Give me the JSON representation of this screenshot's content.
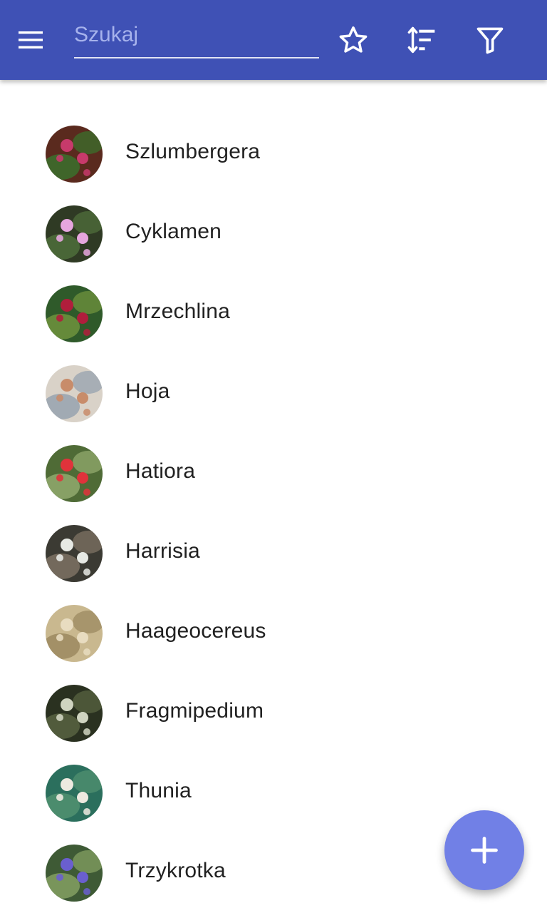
{
  "toolbar": {
    "search_placeholder": "Szukaj",
    "search_value": "",
    "menu_icon": "hamburger-menu-icon",
    "favorite_icon": "star-outline-icon",
    "sort_icon": "sort-icon",
    "filter_icon": "filter-icon",
    "color": "#3f51b5"
  },
  "plants": [
    {
      "name": "Szlumbergera",
      "thumb_colors": [
        "#5a2a1e",
        "#c73a6b",
        "#3c6b2b"
      ]
    },
    {
      "name": "Cyklamen",
      "thumb_colors": [
        "#2f3a24",
        "#e6a6de",
        "#4d6b3a"
      ]
    },
    {
      "name": "Mrzechlina",
      "thumb_colors": [
        "#2f5a2a",
        "#b01e3c",
        "#6c8f3c"
      ]
    },
    {
      "name": "Hoja",
      "thumb_colors": [
        "#d9d2c8",
        "#c88c6a",
        "#9aa5b0"
      ]
    },
    {
      "name": "Hatiora",
      "thumb_colors": [
        "#4f6b36",
        "#e0333b",
        "#8da66a"
      ]
    },
    {
      "name": "Harrisia",
      "thumb_colors": [
        "#3b3a33",
        "#e7e9e4",
        "#7a6f60"
      ]
    },
    {
      "name": "Haageocereus",
      "thumb_colors": [
        "#c9b88f",
        "#e8dcc0",
        "#9f8c63"
      ]
    },
    {
      "name": "Fragmipedium",
      "thumb_colors": [
        "#2a3120",
        "#cfd4c0",
        "#55603f"
      ]
    },
    {
      "name": "Thunia",
      "thumb_colors": [
        "#2b6f5d",
        "#eeeae0",
        "#4f8f6f"
      ]
    },
    {
      "name": "Trzykrotka",
      "thumb_colors": [
        "#3e5a35",
        "#6a5fcf",
        "#7f9b5f"
      ]
    }
  ],
  "fab": {
    "icon": "plus-icon",
    "color": "#7180e6"
  }
}
